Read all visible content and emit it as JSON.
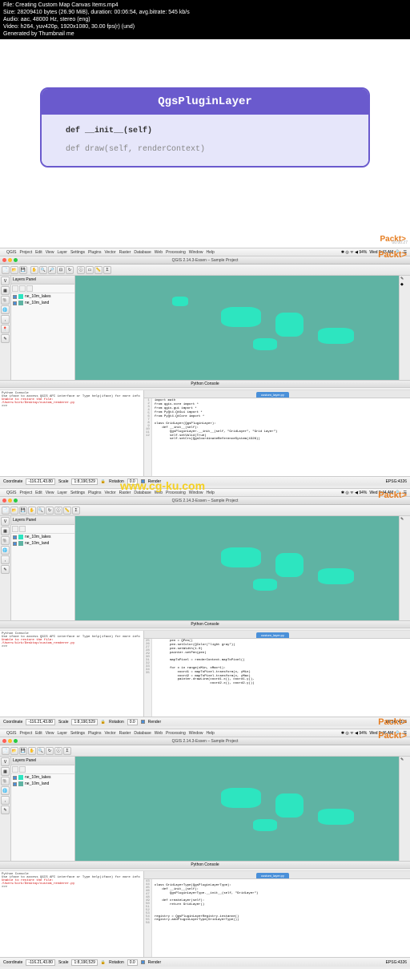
{
  "header": {
    "file": "File: Creating Custom Map Canvas Items.mp4",
    "size": "Size: 28209410 bytes (26.90 MiB), duration: 00:06:54, avg.bitrate: 545 kb/s",
    "audio": "Audio: aac, 48000 Hz, stereo (eng)",
    "video": "Video: h264, yuv420p, 1920x1080, 30.00 fps(r) (und)",
    "gen": "Generated by Thumbnail me"
  },
  "slide": {
    "title": "QgsPluginLayer",
    "line1": "def __init__(self)",
    "line2": "def draw(self, renderContext)",
    "packt": "Packt>",
    "ts": "00:00:27"
  },
  "watermark": "www.cg-ku.com",
  "menubar": {
    "items": [
      "QGIS",
      "Project",
      "Edit",
      "View",
      "Layer",
      "Settings",
      "Plugins",
      "Vector",
      "Raster",
      "Database",
      "Web",
      "Processing",
      "Window",
      "Help"
    ],
    "right_icons": "✱ ◎ ᯤ ◀ 94%",
    "time1": "Wed 8:43 AM",
    "time2": "Wed 8:44 AM",
    "time3": "Wed 8:46 AM"
  },
  "window": {
    "title": "QGIS 2.14.3-Essen – Sample Project"
  },
  "layers": {
    "panel_title": "Layers Panel",
    "items": [
      {
        "name": "ne_10m_lakes",
        "color": "#2de5c0"
      },
      {
        "name": "ne_10m_land",
        "color": "#5fb3a3"
      }
    ]
  },
  "console": {
    "title": "Python Console",
    "left_msg": "Python Console",
    "left_help": "Use iface to access QGIS API interface or Type help(iface) for more info",
    "left_warn1": "Unable to restore the file:",
    "left_warn2": "/Users/kirk/Desktop/custom_renderer.py",
    "tab": "custom_layer.py",
    "code1_lines": [
      "1",
      "2",
      "3",
      "4",
      "5",
      "6",
      "7",
      "8",
      "9",
      "10",
      "11",
      "12"
    ],
    "code1": "import math\nfrom qgis.core import *\nfrom qgis.gui import *\nfrom PyQt4.QtGui import *\nfrom PyQt4.QtCore import *\n\nclass GridLayer(QgsPluginLayer):\n    def __init__(self):\n        QgsPluginLayer.__init__(self, \"GridLayer\", \"Grid Layer\")\n        self.setValid(True)\n        self.setCrs(QgsCoordinateReferenceSystem(4326))",
    "code2_lines": [
      "25",
      "26",
      "27",
      "28",
      "29",
      "30",
      "31",
      "32",
      "33",
      "34",
      "35"
    ],
    "code2": "        pen = QPen()\n        pen.setColor(QColor(\"light gray\"))\n        pen.setWidth(1.0)\n        painter.setPen(pen)\n\n        mapToPixel = renderContext.mapToPixel()\n\n        for x in range(xMin, xMax+1):\n            coord1 = mapToPixel.transform(x, yMin)\n            coord2 = mapToPixel.transform(x, yMax)\n            painter.drawLine(coord1.x(), coord1.y(),\n                             coord2.x(), coord2.y())",
    "code3_lines": [
      "43",
      "44",
      "45",
      "46",
      "47",
      "48",
      "49",
      "50",
      "51",
      "52",
      "53",
      "54",
      "55",
      "56"
    ],
    "code3": "\nclass GridLayerType(QgsPluginLayerType):\n    def __init__(self):\n        QgsPluginLayerType.__init__(self, \"GridLayer\")\n\n    def createLayer(self):\n        return GridLayer()\n\n\nregistry = QgsPluginLayerRegistry.instance()\nregistry.addPluginLayerType(GridLayerType())",
    "prompt": ">>>"
  },
  "statusbar": {
    "coord_label": "Coordinate",
    "coord_value": "-116.21,43.80",
    "scale_label": "Scale",
    "scale_value": "1:8,190,529",
    "rotation_label": "Rotation",
    "rotation_value": "0.0",
    "render": "Render",
    "epsg": "EPSG:4326"
  },
  "packt": "Packt>",
  "ts2": "00:02:02",
  "ts3": "00:03:47",
  "ts4": "00:05:22"
}
